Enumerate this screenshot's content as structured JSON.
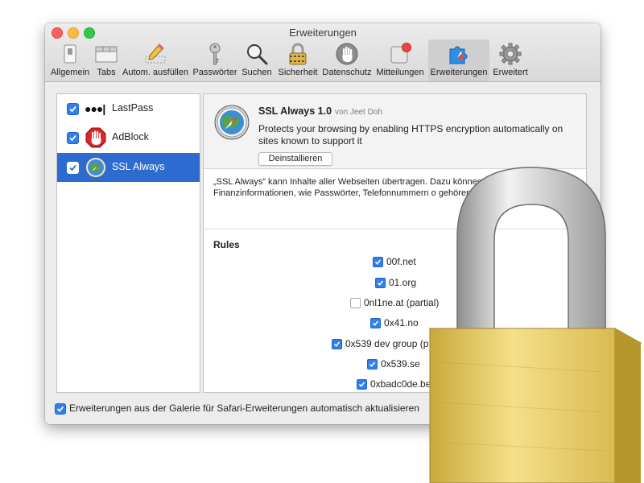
{
  "window": {
    "title": "Erweiterungen"
  },
  "toolbar": {
    "items": [
      {
        "label": "Allgemein",
        "icon": "switch-icon"
      },
      {
        "label": "Tabs",
        "icon": "tabs-icon"
      },
      {
        "label": "Autom. ausfüllen",
        "icon": "pencil-icon"
      },
      {
        "label": "Passwörter",
        "icon": "key-icon"
      },
      {
        "label": "Suchen",
        "icon": "magnifier-icon"
      },
      {
        "label": "Sicherheit",
        "icon": "lock-icon"
      },
      {
        "label": "Datenschutz",
        "icon": "hand-icon"
      },
      {
        "label": "Mitteilungen",
        "icon": "notification-icon"
      },
      {
        "label": "Erweiterungen",
        "icon": "puzzle-icon",
        "active": true
      },
      {
        "label": "Erweitert",
        "icon": "gear-icon"
      }
    ]
  },
  "sidebar": {
    "items": [
      {
        "label": "LastPass",
        "icon_text": "●●●|",
        "checked": true
      },
      {
        "label": "AdBlock",
        "checked": true
      },
      {
        "label": "SSL Always",
        "checked": true,
        "selected": true
      }
    ]
  },
  "extension": {
    "name": "SSL Always 1.0",
    "author": "von Jeet Doh",
    "description": "Protects your browsing by enabling HTTPS encryption automatically on sites known to support it",
    "uninstall_label": "Deinstallieren",
    "warning": "„SSL Always“ kann Inhalte aller Webseiten übertragen. Dazu können oder Finanzinformationen, wie Passwörter, Telefonnummern o gehören."
  },
  "rules": {
    "title": "Rules",
    "items": [
      {
        "label": "00f.net",
        "checked": true
      },
      {
        "label": "01.org",
        "checked": true
      },
      {
        "label": "0nl1ne.at (partial)",
        "checked": false
      },
      {
        "label": "0x41.no",
        "checked": true
      },
      {
        "label": "0x539 dev group (p",
        "checked": true
      },
      {
        "label": "0x539.se",
        "checked": true
      },
      {
        "label": "0xbadc0de.be",
        "checked": true
      }
    ]
  },
  "footer": {
    "auto_update_label": "Erweiterungen aus der Galerie für Safari-Erweiterungen automatisch aktualisieren",
    "checked": true
  },
  "colors": {
    "accent": "#2f80ed",
    "selection": "#2e6bd1",
    "padlock_body": "#e8d26a",
    "padlock_shackle": "#d8d8d8"
  }
}
